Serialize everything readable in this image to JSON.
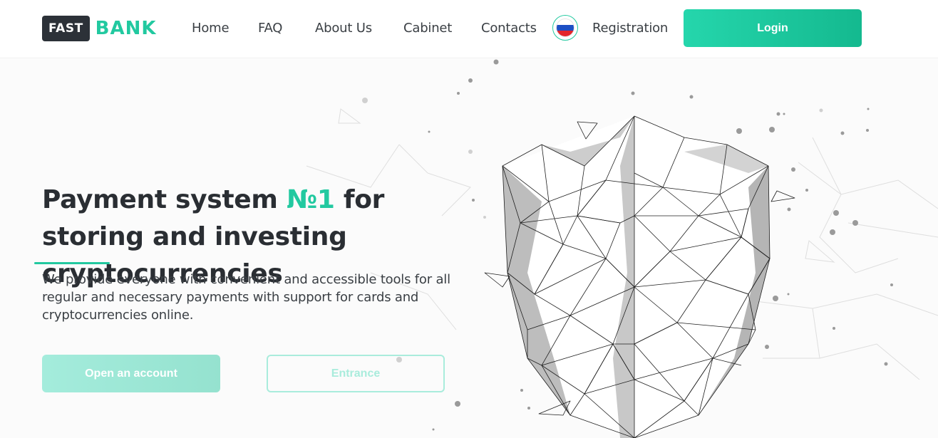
{
  "logo": {
    "part1": "FAST",
    "part2": "BANK"
  },
  "nav": [
    {
      "label": "Home"
    },
    {
      "label": "FAQ"
    },
    {
      "label": "About Us"
    },
    {
      "label": "Cabinet"
    },
    {
      "label": "Contacts"
    },
    {
      "label": "Registration"
    }
  ],
  "language": {
    "icon": "russia-flag-icon",
    "colors": [
      "#ffffff",
      "#1c4fc4",
      "#e3262b"
    ]
  },
  "header": {
    "login_label": "Login"
  },
  "hero": {
    "headline_part1": "Payment system ",
    "headline_accent": "№1",
    "headline_part2": " for storing and investing cryptocurrencies",
    "description": "We provide everyone with convenient and accessible tools for all regular and necessary payments with support for cards and cryptocurrencies online.",
    "open_account_label": "Open an account",
    "entrance_label": "Entrance",
    "illustration": "polygonal-shield-icon"
  },
  "colors": {
    "accent": "#22c9a0",
    "dark": "#2c3138",
    "text": "#2a2e33"
  }
}
